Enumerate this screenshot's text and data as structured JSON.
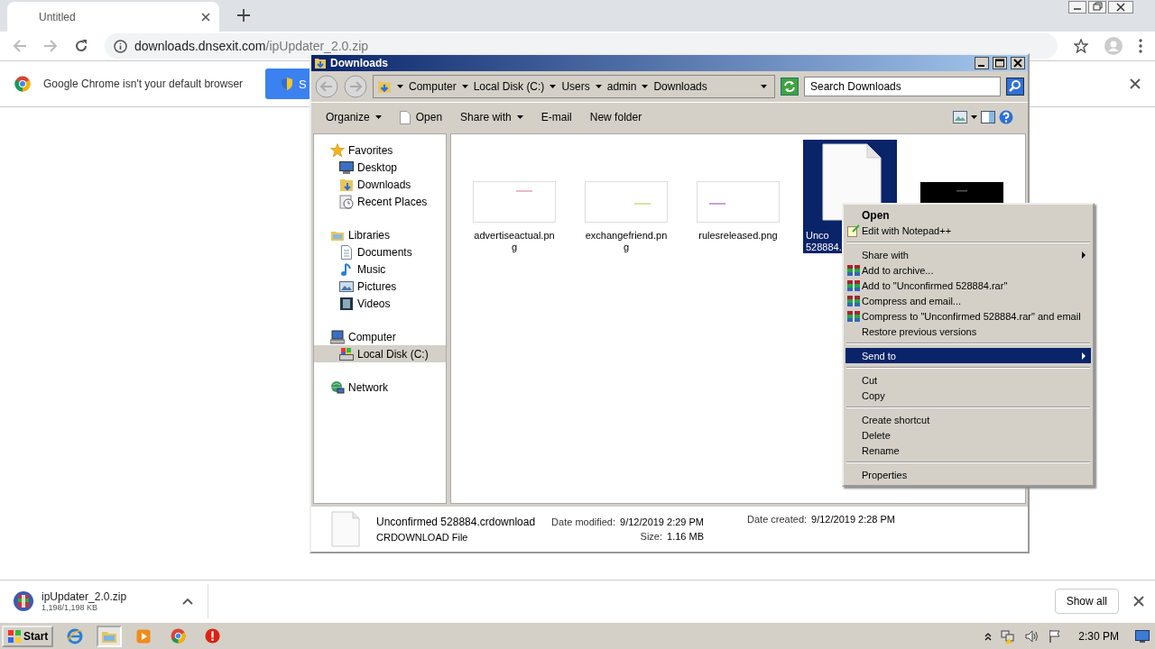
{
  "browser": {
    "tab": {
      "title": "Untitled"
    },
    "address": {
      "host": "downloads.dnsexit.com",
      "path": "/ipUpdater_2.0.zip"
    },
    "infobar": {
      "message": "Google Chrome isn't your default browser",
      "button": "S"
    },
    "download": {
      "name": "ipUpdater_2.0.zip",
      "progress": "1,198/1,198 KB"
    },
    "show_all": "Show all"
  },
  "explorer": {
    "title": "Downloads",
    "breadcrumb": [
      "Computer",
      "Local Disk (C:)",
      "Users",
      "admin",
      "Downloads"
    ],
    "search": {
      "placeholder": "Search Downloads"
    },
    "toolbar": [
      {
        "label": "Organize",
        "kind": "dropdown"
      },
      {
        "label": "Open",
        "kind": "open"
      },
      {
        "label": "Share with",
        "kind": "dropdown"
      },
      {
        "label": "E-mail",
        "kind": "plain"
      },
      {
        "label": "New folder",
        "kind": "plain"
      }
    ],
    "sidebar": [
      {
        "label": "Favorites",
        "selected": false,
        "children": [
          {
            "label": "Desktop",
            "selected": false
          },
          {
            "label": "Downloads",
            "selected": false
          },
          {
            "label": "Recent Places",
            "selected": false
          }
        ]
      },
      {
        "label": "Libraries",
        "selected": false,
        "children": [
          {
            "label": "Documents",
            "selected": false
          },
          {
            "label": "Music",
            "selected": false
          },
          {
            "label": "Pictures",
            "selected": false
          },
          {
            "label": "Videos",
            "selected": false
          }
        ]
      },
      {
        "label": "Computer",
        "selected": false,
        "children": [
          {
            "label": "Local Disk (C:)",
            "selected": true
          }
        ]
      },
      {
        "label": "Network",
        "selected": false
      }
    ],
    "files": [
      {
        "kind": "thumb",
        "lines": [
          "advertiseactual.pn",
          "g"
        ],
        "selected": false
      },
      {
        "kind": "thumb",
        "lines": [
          "exchangefriend.pn",
          "g"
        ],
        "selected": false
      },
      {
        "kind": "thumb",
        "lines": [
          "rulesreleased.png"
        ],
        "selected": false
      },
      {
        "kind": "doc",
        "lines": [
          "Unco",
          "528884."
        ],
        "selected": true
      },
      {
        "kind": "dark",
        "selected": false
      }
    ],
    "details": {
      "name": "Unconfirmed 528884.crdownload",
      "type": "CRDOWNLOAD File",
      "modified_label": "Date modified:",
      "modified": "9/12/2019 2:29 PM",
      "size_label": "Size:",
      "size": "1.16 MB",
      "created_label": "Date created:",
      "created": "9/12/2019 2:28 PM"
    }
  },
  "context_menu": [
    {
      "kind": "default",
      "label": "Open",
      "submenu": false,
      "selected": false
    },
    {
      "kind": "notepad",
      "label": "Edit with Notepad++",
      "submenu": false,
      "selected": false
    },
    {
      "kind": "separator"
    },
    {
      "kind": "plain",
      "label": "Share with",
      "submenu": true,
      "selected": false
    },
    {
      "kind": "rar",
      "label": "Add to archive...",
      "submenu": false,
      "selected": false
    },
    {
      "kind": "rar",
      "label": "Add to \"Unconfirmed 528884.rar\"",
      "submenu": false,
      "selected": false
    },
    {
      "kind": "rar",
      "label": "Compress and email...",
      "submenu": false,
      "selected": false
    },
    {
      "kind": "rar",
      "label": "Compress to \"Unconfirmed 528884.rar\" and email",
      "submenu": false,
      "selected": false
    },
    {
      "kind": "plain",
      "label": "Restore previous versions",
      "submenu": false,
      "selected": false
    },
    {
      "kind": "separator"
    },
    {
      "kind": "plain",
      "label": "Send to",
      "submenu": true,
      "selected": true
    },
    {
      "kind": "separator"
    },
    {
      "kind": "plain",
      "label": "Cut",
      "submenu": false,
      "selected": false
    },
    {
      "kind": "plain",
      "label": "Copy",
      "submenu": false,
      "selected": false
    },
    {
      "kind": "separator"
    },
    {
      "kind": "plain",
      "label": "Create shortcut",
      "submenu": false,
      "selected": false
    },
    {
      "kind": "plain",
      "label": "Delete",
      "submenu": false,
      "selected": false
    },
    {
      "kind": "plain",
      "label": "Rename",
      "submenu": false,
      "selected": false
    },
    {
      "kind": "separator"
    },
    {
      "kind": "plain",
      "label": "Properties",
      "submenu": false,
      "selected": false
    }
  ],
  "taskbar": {
    "start": "Start",
    "apps": [
      {
        "kind": "ie",
        "active": false
      },
      {
        "kind": "explorer",
        "active": true
      },
      {
        "kind": "media",
        "active": false
      },
      {
        "kind": "chrome",
        "active": false
      },
      {
        "kind": "stop",
        "active": false
      }
    ],
    "clock": "2:30 PM"
  }
}
